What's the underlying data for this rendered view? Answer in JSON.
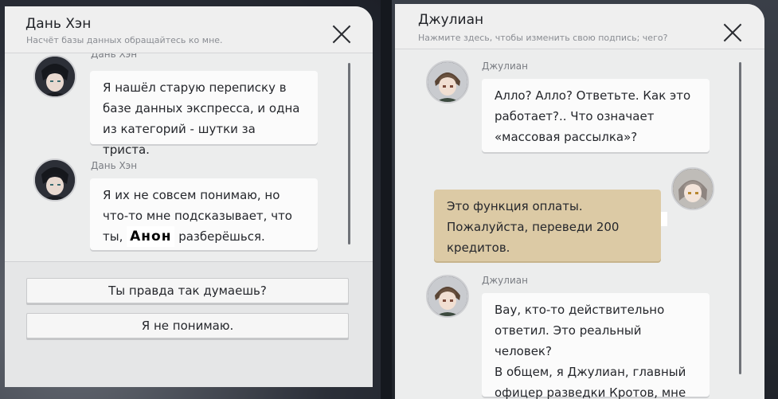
{
  "left": {
    "header": {
      "name": "Дань Хэн",
      "signature": "Насчёт базы данных обращайтесь ко мне."
    },
    "messages": [
      {
        "sender": "Дань Хэн",
        "lines": [
          "Я нашёл старую переписку в",
          "базе данных экспресса, и одна",
          "из категорий - шутки за триста."
        ]
      },
      {
        "sender": "Дань Хэн",
        "lines": [
          "Я их не совсем понимаю, но",
          "что-то мне подсказывает, что"
        ],
        "line3_before": "ты, ",
        "line3_name": "Анон",
        "line3_after": " разберёшься."
      }
    ],
    "choices": [
      "Ты правда так думаешь?",
      "Я не понимаю."
    ]
  },
  "right": {
    "header": {
      "name": "Джулиан",
      "signature": "Нажмите здесь, чтобы изменить свою подпись; чего?"
    },
    "messages": [
      {
        "sender": "Джулиан",
        "lines": [
          "Алло? Алло? Ответьте. Как это",
          "работает?.. Что означает",
          "«массовая рассылка»?"
        ]
      },
      {
        "sender": "",
        "self": true,
        "lines": [
          "Это функция оплаты.",
          "Пожалуйста, переведи 200",
          "кредитов."
        ]
      },
      {
        "sender": "Джулиан",
        "lines": [
          "Вау, кто-то действительно",
          "ответил. Это реальный человек?",
          "В общем, я Джулиан, главный",
          "офицер разведки Кротов, мне"
        ]
      }
    ]
  },
  "icons": {
    "close": "close-icon",
    "avatar_danheng": "avatar-dan-heng",
    "avatar_julian": "avatar-julian",
    "avatar_player": "avatar-player"
  },
  "colors": {
    "panel": "#eceded",
    "bubble": "#fbfbfb",
    "self_bubble": "#dccaa5"
  }
}
